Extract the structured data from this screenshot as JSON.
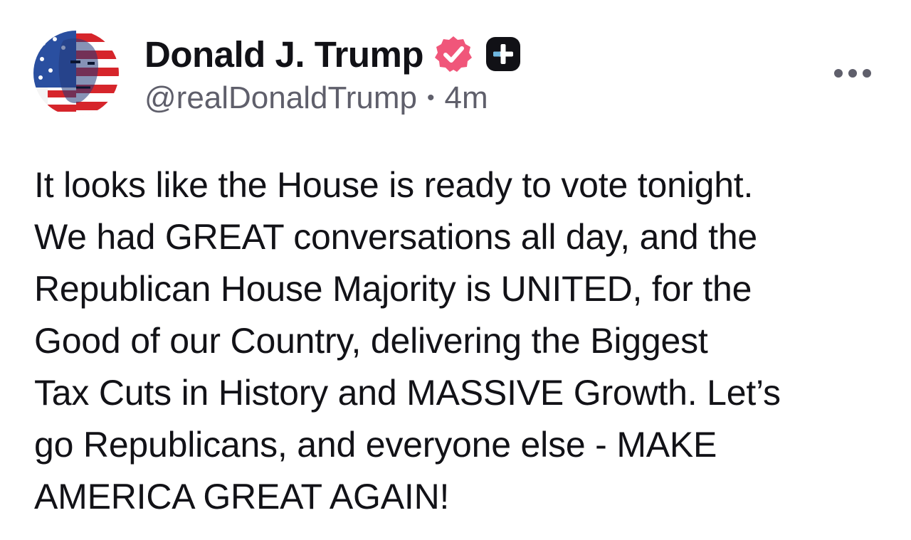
{
  "post": {
    "author": {
      "display_name": "Donald J. Trump",
      "handle": "@realDonaldTrump",
      "avatar_icon": "profile-avatar"
    },
    "timestamp": "4m",
    "separator": "•",
    "badges": [
      {
        "icon": "verified-badge-icon",
        "color": "#f0567a"
      },
      {
        "icon": "plus-badge-icon",
        "color": "#111116"
      }
    ],
    "more_icon": "more-horizontal-icon",
    "body_lines": [
      "It looks like the House is ready to vote tonight.",
      "We had GREAT conversations all day, and the",
      "Republican House Majority is UNITED, for the",
      "Good of our Country, delivering the Biggest",
      "Tax Cuts in History and MASSIVE Growth. Let’s",
      "go Republicans, and everyone else - MAKE",
      "AMERICA GREAT AGAIN!"
    ]
  },
  "colors": {
    "background": "#ffffff",
    "text": "#121217",
    "secondary_text": "#5f5f6b",
    "verified": "#f0567a",
    "icon_dark": "#111116"
  }
}
